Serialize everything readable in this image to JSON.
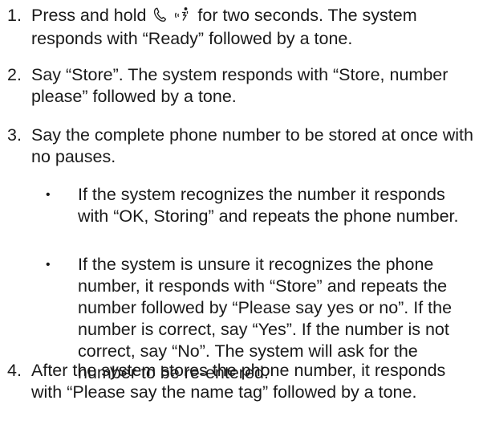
{
  "steps": [
    {
      "number": "1.",
      "text_before_icons": "Press and hold",
      "icons": [
        "phone-handset-icon",
        "voice-command-icon"
      ],
      "text_after_icons": "for two seconds. The system responds with “Ready” followed by a tone."
    },
    {
      "number": "2.",
      "text": "Say “Store”. The system responds with “Store, number please” followed by a tone."
    },
    {
      "number": "3.",
      "text": "Say the complete phone number to be stored at once with no pauses.",
      "bullets": [
        {
          "symbol": "•",
          "text": "If the system recognizes the number it responds with “OK, Storing” and repeats the phone number."
        },
        {
          "symbol": "•",
          "text": "If the system is unsure it recognizes the phone number, it responds with “Store” and repeats the number followed by “Please say yes or no”. If the number is correct, say “Yes”. If the number is not correct, say “No”. The system will ask for the number to be re-entered."
        }
      ]
    },
    {
      "number": "4.",
      "text": "After the system stores the phone number, it responds with “Please say the name tag” followed by a tone."
    }
  ]
}
